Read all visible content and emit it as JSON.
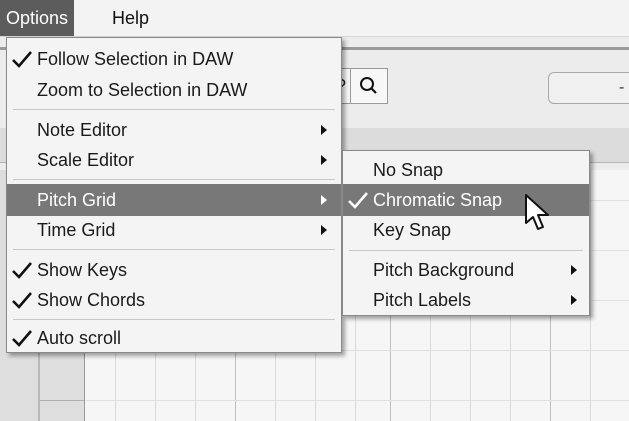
{
  "menubar": {
    "items": [
      {
        "label": "Options"
      },
      {
        "label": "Help"
      }
    ]
  },
  "toolbar": {
    "zoom_partial_glyph": "?",
    "field_value": "-"
  },
  "options_menu": {
    "items": [
      {
        "label": "Follow Selection in DAW",
        "checked": true
      },
      {
        "label": "Zoom to Selection in DAW",
        "checked": false
      },
      {
        "label": "Note Editor",
        "submenu": true
      },
      {
        "label": "Scale Editor",
        "submenu": true
      },
      {
        "label": "Pitch Grid",
        "submenu": true,
        "highlighted": true
      },
      {
        "label": "Time Grid",
        "submenu": true
      },
      {
        "label": "Show Keys",
        "checked": true
      },
      {
        "label": "Show Chords",
        "checked": true
      },
      {
        "label": "Auto scroll",
        "checked": true
      }
    ]
  },
  "pitch_grid_menu": {
    "items": [
      {
        "label": "No Snap"
      },
      {
        "label": "Chromatic Snap",
        "checked": true,
        "highlighted": true
      },
      {
        "label": "Key Snap"
      },
      {
        "label": "Pitch Background",
        "submenu": true
      },
      {
        "label": "Pitch Labels",
        "submenu": true
      }
    ]
  },
  "icons": {
    "check": "checkmark-icon",
    "arrow": "submenu-arrow-icon",
    "zoom": "magnifier-icon",
    "cursor": "mouse-pointer-icon"
  },
  "colors": {
    "highlight": "#787878",
    "menubar_active": "#5c5c5c"
  }
}
